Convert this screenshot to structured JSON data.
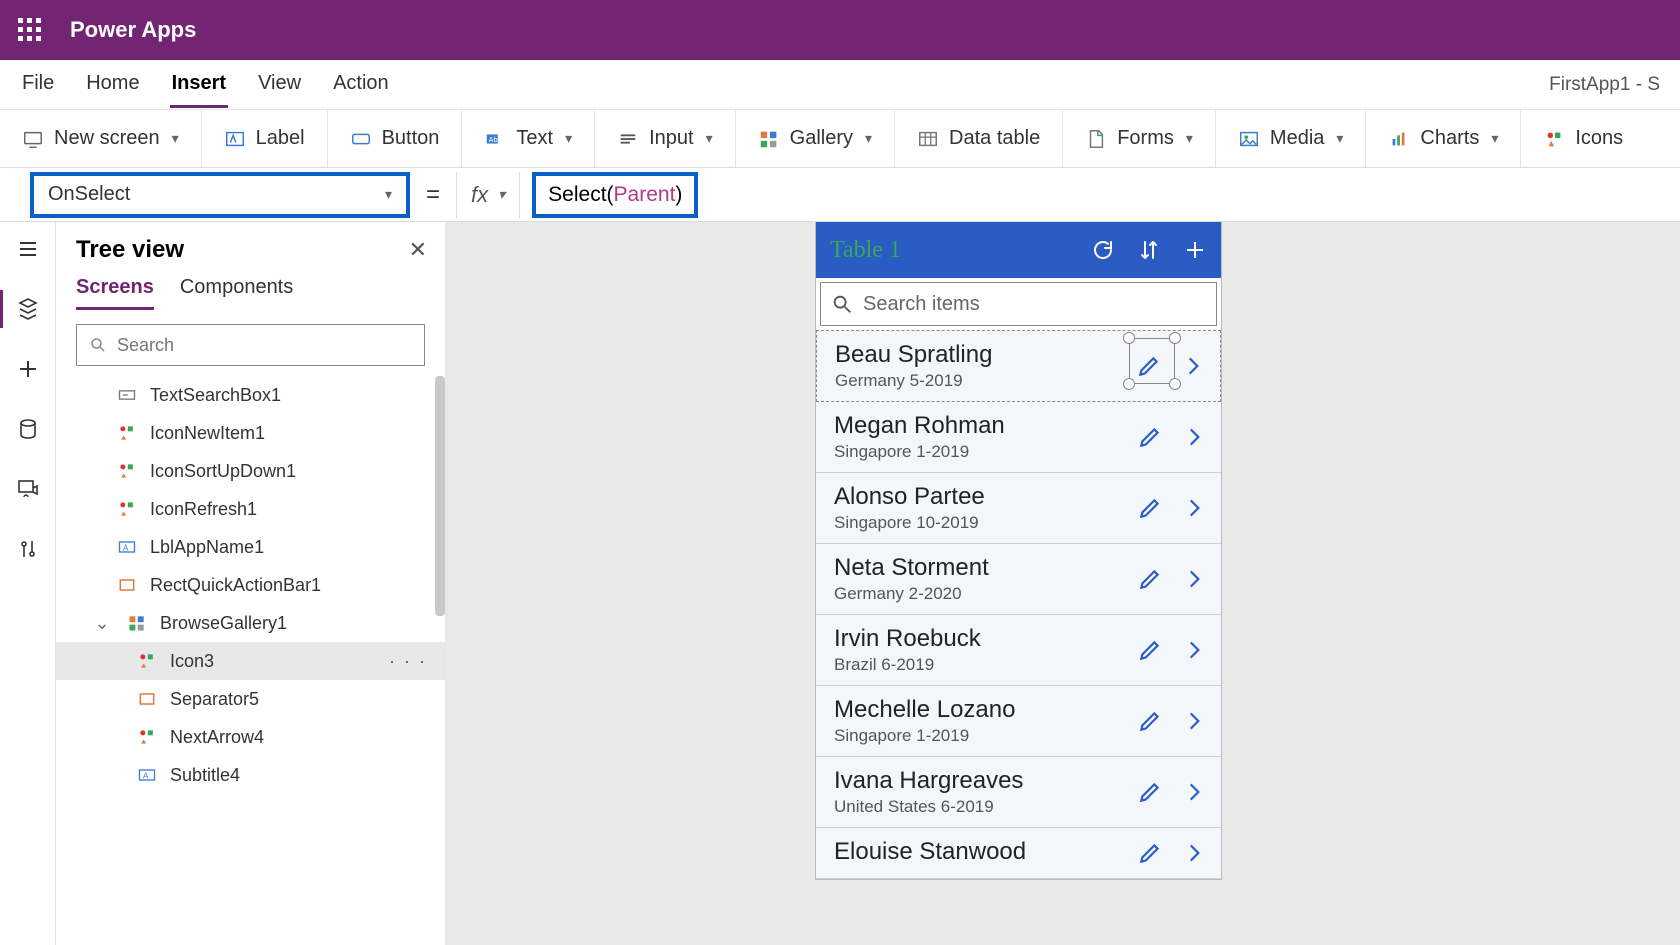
{
  "header": {
    "app_title": "Power Apps"
  },
  "menubar": {
    "items": [
      "File",
      "Home",
      "Insert",
      "View",
      "Action"
    ],
    "active_index": 2,
    "right_text": "FirstApp1 - S"
  },
  "ribbon": {
    "new_screen": "New screen",
    "label": "Label",
    "button": "Button",
    "text": "Text",
    "input": "Input",
    "gallery": "Gallery",
    "data_table": "Data table",
    "forms": "Forms",
    "media": "Media",
    "charts": "Charts",
    "icons": "Icons"
  },
  "formula": {
    "property": "OnSelect",
    "fx_label": "fx",
    "code_fn": "Select",
    "code_arg": "Parent"
  },
  "tree": {
    "title": "Tree view",
    "tabs": [
      "Screens",
      "Components"
    ],
    "active_tab": 0,
    "search_placeholder": "Search",
    "items": [
      {
        "type": "textbox",
        "label": "TextSearchBox1",
        "indent": 1
      },
      {
        "type": "iconset",
        "label": "IconNewItem1",
        "indent": 1
      },
      {
        "type": "iconset",
        "label": "IconSortUpDown1",
        "indent": 1
      },
      {
        "type": "iconset",
        "label": "IconRefresh1",
        "indent": 1
      },
      {
        "type": "label",
        "label": "LblAppName1",
        "indent": 1
      },
      {
        "type": "rect",
        "label": "RectQuickActionBar1",
        "indent": 1
      },
      {
        "type": "gallery",
        "label": "BrowseGallery1",
        "indent": 1,
        "expandable": true
      },
      {
        "type": "iconset",
        "label": "Icon3",
        "indent": 2,
        "selected": true,
        "more": true
      },
      {
        "type": "rect",
        "label": "Separator5",
        "indent": 2
      },
      {
        "type": "iconset",
        "label": "NextArrow4",
        "indent": 2
      },
      {
        "type": "label",
        "label": "Subtitle4",
        "indent": 2
      }
    ]
  },
  "phone": {
    "title": "Table 1",
    "search_placeholder": "Search items",
    "rows": [
      {
        "name": "Beau Spratling",
        "sub": "Germany 5-2019"
      },
      {
        "name": "Megan Rohman",
        "sub": "Singapore 1-2019"
      },
      {
        "name": "Alonso Partee",
        "sub": "Singapore 10-2019"
      },
      {
        "name": "Neta Storment",
        "sub": "Germany 2-2020"
      },
      {
        "name": "Irvin Roebuck",
        "sub": "Brazil 6-2019"
      },
      {
        "name": "Mechelle Lozano",
        "sub": "Singapore 1-2019"
      },
      {
        "name": "Ivana Hargreaves",
        "sub": "United States 6-2019"
      },
      {
        "name": "Elouise Stanwood",
        "sub": ""
      }
    ]
  }
}
